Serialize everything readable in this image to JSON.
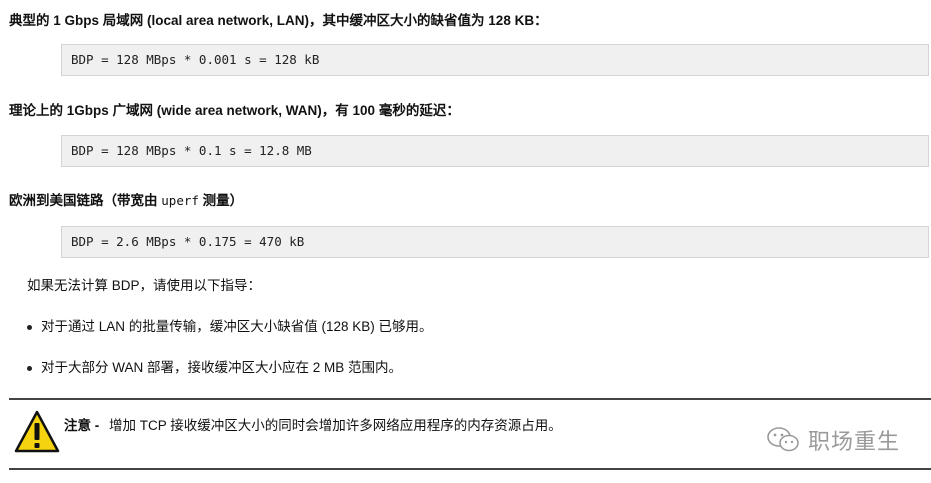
{
  "sections": [
    {
      "heading": "典型的 1 Gbps 局域网 (local area network, LAN)，其中缓冲区大小的缺省值为 128 KB：",
      "code": "BDP = 128 MBps * 0.001 s = 128 kB"
    },
    {
      "heading": "理论上的 1Gbps 广域网 (wide area network, WAN)，有 100 毫秒的延迟：",
      "code": "BDP = 128 MBps * 0.1 s = 12.8 MB"
    },
    {
      "heading_prefix": "欧洲到美国链路（带宽由 ",
      "heading_code": "uperf",
      "heading_suffix": " 测量）",
      "code": "BDP = 2.6 MBps * 0.175 = 470 kB"
    }
  ],
  "guidance": "如果无法计算 BDP，请使用以下指导：",
  "bullets": [
    "对于通过 LAN 的批量传输，缓冲区大小缺省值 (128 KB) 已够用。",
    "对于大部分 WAN 部署，接收缓冲区大小应在 2 MB 范围内。"
  ],
  "note": {
    "label": "注意 -",
    "text": "增加 TCP 接收缓冲区大小的同时会增加许多网络应用程序的内存资源占用。",
    "icon": "warning-triangle-icon",
    "icon_color": "#f5d40f"
  },
  "watermark": {
    "text": "职场重生",
    "icon": "wechat-icon"
  }
}
